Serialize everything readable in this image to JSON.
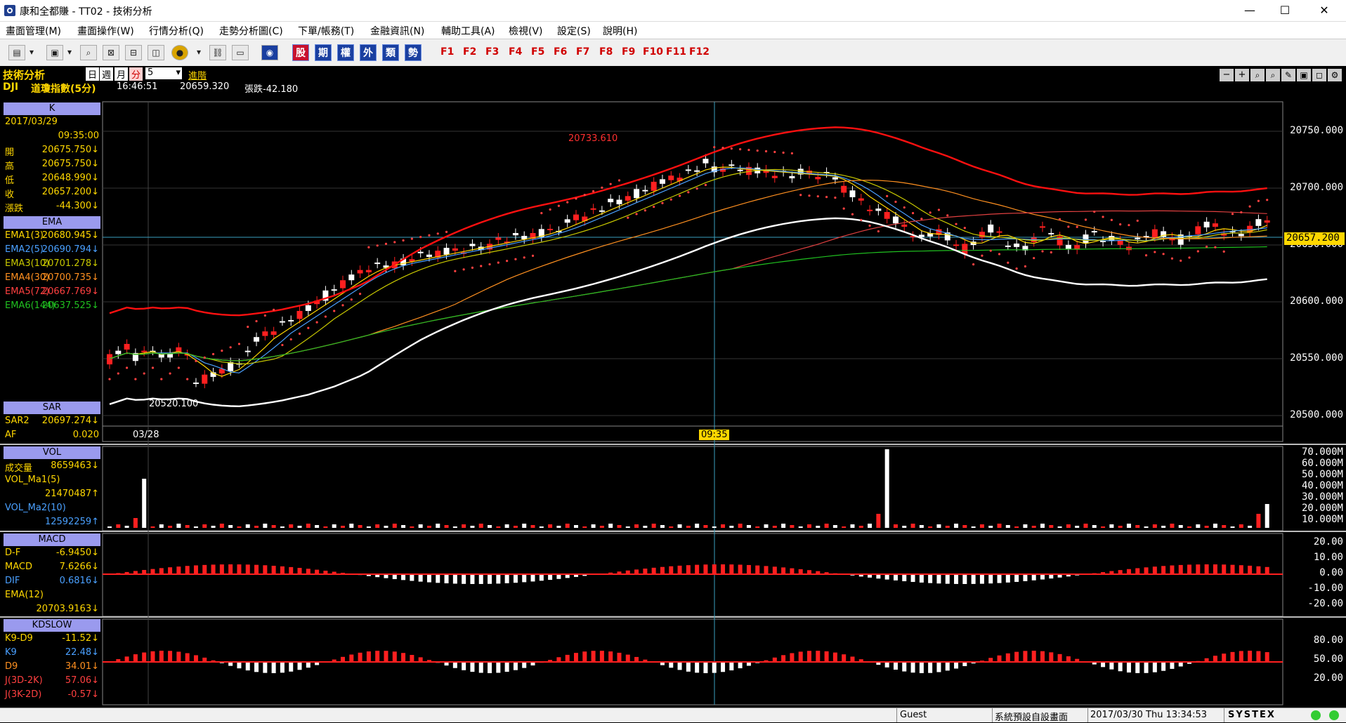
{
  "window": {
    "title": "康和全都賺 - TT02 - 技術分析",
    "min": "—",
    "max": "☐",
    "close": "✕"
  },
  "menu": [
    "畫面管理(M)",
    "畫面操作(W)",
    "行情分析(Q)",
    "走勢分析圖(C)",
    "下單/帳務(T)",
    "金融資訊(N)",
    "輔助工具(A)",
    "檢視(V)",
    "設定(S)",
    "說明(H)"
  ],
  "toolbar": {
    "quick": [
      "股",
      "期",
      "權",
      "外",
      "類",
      "勢"
    ],
    "fkeys": [
      "F1",
      "F2",
      "F3",
      "F4",
      "F5",
      "F6",
      "F7",
      "F8",
      "F9",
      "F10",
      "F11",
      "F12"
    ]
  },
  "header": {
    "module": "技術分析",
    "periods": [
      "日",
      "週",
      "月",
      "分"
    ],
    "interval": "5",
    "advanced": "進階",
    "symbol": "DJI",
    "name": "道瓊指數(5分)",
    "time": "16:46:51",
    "price": "20659.320",
    "change": "張跌-42.180"
  },
  "k_panel": {
    "head": "K",
    "date": "2017/03/29",
    "time": "09:35:00",
    "rows": [
      [
        "開",
        "20675.750↓"
      ],
      [
        "高",
        "20675.750↓"
      ],
      [
        "低",
        "20648.990↓"
      ],
      [
        "收",
        "20657.200↓"
      ],
      [
        "漲跌",
        "-44.300↓"
      ]
    ]
  },
  "ema_panel": {
    "head": "EMA",
    "rows": [
      [
        "EMA1(3)",
        "20680.945↓",
        "#ffd700"
      ],
      [
        "EMA2(5)",
        "20690.794↓",
        "#4aa0ff"
      ],
      [
        "EMA3(10)",
        "20701.278↓",
        "#c8c800"
      ],
      [
        "EMA4(30)",
        "20700.735↓",
        "#ff9020"
      ],
      [
        "EMA5(72)",
        "20667.769↓",
        "#ff4040"
      ],
      [
        "EMA6(144)",
        "20637.525↓",
        "#20c020"
      ]
    ]
  },
  "sar_panel": {
    "head": "SAR",
    "rows": [
      [
        "SAR2",
        "20697.274↓"
      ],
      [
        "AF",
        "0.020"
      ]
    ]
  },
  "vol_panel": {
    "head": "VOL",
    "rows": [
      [
        "成交量",
        "8659463↓",
        "#ffd700"
      ],
      [
        "VOL_Ma1(5)",
        "",
        ""
      ],
      [
        "",
        "21470487↑",
        "#ffd700"
      ],
      [
        "VOL_Ma2(10)",
        "",
        "#4aa0ff"
      ],
      [
        "",
        "12592259↑",
        "#4aa0ff"
      ]
    ]
  },
  "macd_panel": {
    "head": "MACD",
    "rows": [
      [
        "D-F",
        "-6.9450↓",
        "#ffd700"
      ],
      [
        "MACD",
        "7.6266↓",
        "#ffd700"
      ],
      [
        "DIF",
        "0.6816↓",
        "#4aa0ff"
      ],
      [
        "EMA(12)",
        "",
        ""
      ],
      [
        "",
        "20703.9163↓",
        "#ffd700"
      ]
    ]
  },
  "kd_panel": {
    "head": "KDSLOW",
    "rows": [
      [
        "K9-D9",
        "-11.52↓",
        "#ffd700"
      ],
      [
        "K9",
        "22.48↓",
        "#4aa0ff"
      ],
      [
        "D9",
        "34.01↓",
        "#ff9020"
      ],
      [
        "J(3D-2K)",
        "57.06↓",
        "#ff4040"
      ],
      [
        "J(3K-2D)",
        "-0.57↓",
        "#ff4040"
      ]
    ]
  },
  "price_axis": [
    "20750.000",
    "20700.000",
    "20650.000",
    "20600.000",
    "20550.000",
    "20500.000"
  ],
  "current_price_tag": "20657.200",
  "vol_axis": [
    "70.000M",
    "60.000M",
    "50.000M",
    "40.000M",
    "30.000M",
    "20.000M",
    "10.000M"
  ],
  "macd_axis": [
    "20.00",
    "10.00",
    "0.00",
    "-10.00",
    "-20.00"
  ],
  "kd_axis": [
    "80.00",
    "50.00",
    "20.00"
  ],
  "annotations": {
    "high": "20733.610",
    "low": "20520.100",
    "date_label": "03/28",
    "cursor_time": "09:35"
  },
  "status": {
    "user": "Guest",
    "layout": "系統預設自設畫面",
    "datetime": "2017/03/30 Thu 13:34:53",
    "brand": "SYSTEX"
  }
}
